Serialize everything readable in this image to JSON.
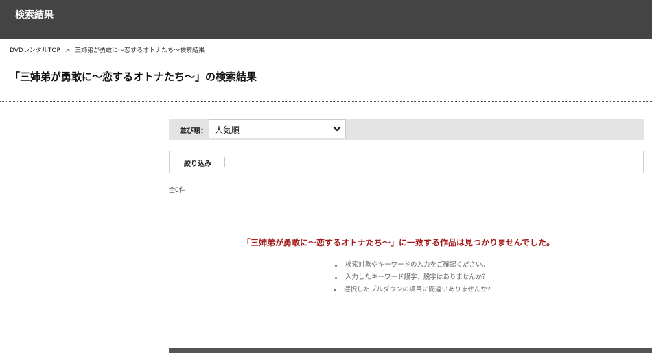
{
  "header": {
    "title": "検索結果"
  },
  "breadcrumb": {
    "home_label": "DVDレンタルTOP",
    "separator": ">",
    "current": "三姉弟が勇敢に〜恋するオトナたち〜検索結果"
  },
  "page": {
    "title": "「三姉弟が勇敢に〜恋するオトナたち〜」の検索結果"
  },
  "sort": {
    "label": "並び順：",
    "selected": "人気順"
  },
  "filter": {
    "label": "絞り込み"
  },
  "results": {
    "count_text": "全0件"
  },
  "no_results": {
    "message": "「三姉弟が勇敢に〜恋するオトナたち〜」に一致する作品は見つかりませんでした。",
    "tips": [
      "検索対象やキーワードの入力をご確認ください。",
      "入力したキーワード誤字、脱字はありませんか？",
      "選択したプルダウンの項目に間違いありませんか?"
    ]
  },
  "icons": {
    "sort_dropdown": "chevron-down-icon"
  },
  "colors": {
    "header_bg": "#444444",
    "sort_bar_bg": "#e3e3e3",
    "no_result_text": "#a51c1c",
    "footer_bar": "#555555"
  }
}
